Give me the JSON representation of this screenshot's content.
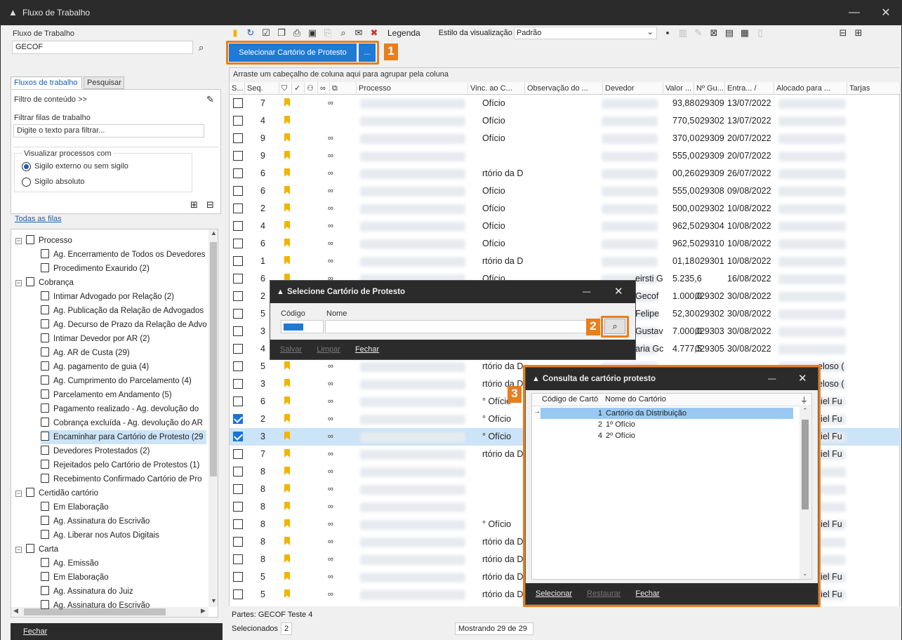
{
  "window": {
    "title": "Fluxo de Trabalho"
  },
  "left": {
    "fluxo_label": "Fluxo de Trabalho",
    "fluxo_value": "GECOF",
    "tabs": [
      "Fluxos de trabalho",
      "Pesquisar"
    ],
    "filter_content": "Filtro de conteúdo >>",
    "filter_label": "Filtrar filas de trabalho",
    "filter_placeholder": "Digite o texto para filtrar...",
    "visualizar_label": "Visualizar processos com",
    "radio1": "Sigilo externo ou sem sigilo",
    "radio2": "Sigilo absoluto",
    "todas_filas": "Todas as filas",
    "fechar": "Fechar"
  },
  "tree": [
    {
      "label": "Processo",
      "level": 0,
      "icon": "document-icon",
      "exp": "−"
    },
    {
      "label": "Ag. Encerramento de Todos os Devedores",
      "level": 1,
      "icon": "document-icon"
    },
    {
      "label": "Procedimento Exaurido (2)",
      "level": 1,
      "icon": "document-icon"
    },
    {
      "label": "Cobrança",
      "level": 0,
      "icon": "document-icon",
      "exp": "−"
    },
    {
      "label": "Intimar Advogado por Relação (2)",
      "level": 1,
      "icon": "document-icon"
    },
    {
      "label": "Ag. Publicação da Relação de Advogados",
      "level": 1,
      "icon": "document-icon"
    },
    {
      "label": "Ag. Decurso de Prazo da Relação de Advo",
      "level": 1,
      "icon": "clock-icon"
    },
    {
      "label": "Intimar Devedor por AR (2)",
      "level": 1,
      "icon": "document-icon"
    },
    {
      "label": "Ag. AR de Custa (29)",
      "level": 1,
      "icon": "document-icon"
    },
    {
      "label": "Ag. pagamento de guia (4)",
      "level": 1,
      "icon": "document-icon"
    },
    {
      "label": "Ag. Cumprimento do Parcelamento (4)",
      "level": 1,
      "icon": "document-icon"
    },
    {
      "label": "Parcelamento em Andamento (5)",
      "level": 1,
      "icon": "document-icon"
    },
    {
      "label": "Pagamento realizado - Ag. devolução do",
      "level": 1,
      "icon": "document-icon"
    },
    {
      "label": "Cobrança excluída - Ag. devolução do AR",
      "level": 1,
      "icon": "document-icon"
    },
    {
      "label": "Encaminhar para Cartório de Protesto (29",
      "level": 1,
      "icon": "documents-icon",
      "selected": true
    },
    {
      "label": "Devedores Protestados (2)",
      "level": 1,
      "icon": "documents-icon"
    },
    {
      "label": "Rejeitados pelo Cartório de Protestos (1)",
      "level": 1,
      "icon": "documents-icon"
    },
    {
      "label": "Recebimento Confirmado Cartório de Pro",
      "level": 1,
      "icon": "documents-icon"
    },
    {
      "label": "Certidão cartório",
      "level": 0,
      "icon": "certificate-icon",
      "exp": "−"
    },
    {
      "label": "Em Elaboração",
      "level": 1,
      "icon": "pen-icon"
    },
    {
      "label": "Ag. Assinatura do Escrivão",
      "level": 1,
      "icon": "signature-icon"
    },
    {
      "label": "Ag. Liberar nos Autos Digitais",
      "level": 1,
      "icon": "documents-icon"
    },
    {
      "label": "Carta",
      "level": 0,
      "icon": "certificate-icon",
      "exp": "−"
    },
    {
      "label": "Ag. Emissão",
      "level": 1,
      "icon": "document-icon"
    },
    {
      "label": "Em Elaboração",
      "level": 1,
      "icon": "pen-icon"
    },
    {
      "label": "Ag. Assinatura do Juiz",
      "level": 1,
      "icon": "signature-icon"
    },
    {
      "label": "Ag. Assinatura do Escrivão",
      "level": 1,
      "icon": "signature-icon"
    }
  ],
  "toolbar": {
    "legenda": "Legenda",
    "estilo_label": "Estilo da visualização",
    "estilo_value": "Padrão",
    "select_btn": "Selecionar Cartório de Protesto",
    "more_btn": "...",
    "step1": "1"
  },
  "grid": {
    "group_hint": "Arraste um cabeçalho de coluna aqui para agrupar pela coluna",
    "headers": [
      "S...",
      "Seq.",
      "Processo",
      "Vinc. ao C...",
      "Observação do ...",
      "Devedor",
      "Valor ...",
      "Nº Gu...",
      "Entra... /",
      "Alocado para ...",
      "Tarjas"
    ],
    "rows": [
      {
        "sel": false,
        "seq": "7",
        "link": true,
        "vinc": "Ofício",
        "dev": "",
        "valor": "93,88",
        "guia": "029309",
        "data": "13/07/2022"
      },
      {
        "sel": false,
        "seq": "4",
        "link": false,
        "vinc": "Ofício",
        "dev": "",
        "valor": "770,5",
        "guia": "029302",
        "data": "13/07/2022"
      },
      {
        "sel": false,
        "seq": "9",
        "link": true,
        "vinc": "Ofício",
        "dev": "",
        "valor": "370,0",
        "guia": "029309",
        "data": "20/07/2022"
      },
      {
        "sel": false,
        "seq": "9",
        "link": true,
        "vinc": "",
        "dev": "",
        "valor": "555,0",
        "guia": "029309",
        "data": "20/07/2022"
      },
      {
        "sel": false,
        "seq": "6",
        "link": true,
        "vinc": "rtório da D",
        "dev": "",
        "valor": "00,26",
        "guia": "029309",
        "data": "26/07/2022"
      },
      {
        "sel": false,
        "seq": "6",
        "link": true,
        "vinc": "Ofício",
        "dev": "",
        "valor": "555,0",
        "guia": "029308",
        "data": "09/08/2022"
      },
      {
        "sel": false,
        "seq": "2",
        "link": true,
        "vinc": "Ofício",
        "dev": "",
        "valor": "500,0",
        "guia": "029302",
        "data": "10/08/2022"
      },
      {
        "sel": false,
        "seq": "4",
        "link": true,
        "vinc": "Ofício",
        "dev": "",
        "valor": "962,5",
        "guia": "029304",
        "data": "10/08/2022"
      },
      {
        "sel": false,
        "seq": "6",
        "link": true,
        "vinc": "Ofício",
        "dev": "",
        "valor": "962,5",
        "guia": "029310",
        "data": "10/08/2022"
      },
      {
        "sel": false,
        "seq": "1",
        "link": true,
        "vinc": "rtório da D",
        "dev": "",
        "valor": "01,18",
        "guia": "029301",
        "data": "10/08/2022"
      },
      {
        "sel": false,
        "seq": "6",
        "link": true,
        "vinc": "Ofício",
        "dev": "eirsti Gecof",
        "valor": "5.235,6",
        "guia": "",
        "data": "16/08/2022"
      },
      {
        "sel": false,
        "seq": "2",
        "link": true,
        "vinc": "",
        "dev": "Gecof",
        "valor": "1.000,0",
        "guia": "029302",
        "data": "30/08/2022"
      },
      {
        "sel": false,
        "seq": "5",
        "link": true,
        "vinc": "",
        "dev": "Felipe",
        "valor": "52,30",
        "guia": "029302",
        "data": "30/08/2022"
      },
      {
        "sel": false,
        "seq": "3",
        "link": true,
        "vinc": "",
        "dev": "Gustavc",
        "valor": "7.000,0",
        "guia": "029303",
        "data": "30/08/2022"
      },
      {
        "sel": false,
        "seq": "4",
        "link": true,
        "vinc": "",
        "dev": "aria Gc",
        "valor": "4.777,5",
        "guia": "029305",
        "data": "30/08/2022"
      },
      {
        "sel": false,
        "seq": "5",
        "link": true,
        "vinc": "rtório da D",
        "dev": "",
        "valor": "",
        "guia": "",
        "data": "",
        "right": "eloso ("
      },
      {
        "sel": false,
        "seq": "3",
        "link": true,
        "vinc": "rtório da D",
        "dev": "",
        "valor": "",
        "guia": "",
        "data": "",
        "right": "eloso ("
      },
      {
        "sel": false,
        "seq": "6",
        "link": true,
        "vinc": "° Ofício",
        "dev": "",
        "valor": "",
        "guia": "",
        "data": "",
        "right": "riel Fu"
      },
      {
        "sel": true,
        "seq": "2",
        "link": true,
        "vinc": "° Ofício",
        "dev": "",
        "valor": "",
        "guia": "",
        "data": "",
        "right": "riel Fu"
      },
      {
        "sel": true,
        "seq": "3",
        "link": true,
        "vinc": "° Ofício",
        "dev": "",
        "valor": "",
        "guia": "",
        "data": "",
        "right": "riel Fu",
        "highlight": true
      },
      {
        "sel": false,
        "seq": "7",
        "link": true,
        "vinc": "rtório da D",
        "dev": "",
        "valor": "",
        "guia": "",
        "data": "",
        "right": "riel Fu"
      },
      {
        "sel": false,
        "seq": "8",
        "link": true,
        "vinc": "",
        "dev": "",
        "valor": "",
        "guia": "",
        "data": "",
        "right": ""
      },
      {
        "sel": false,
        "seq": "8",
        "link": true,
        "vinc": "",
        "dev": "",
        "valor": "",
        "guia": "",
        "data": "",
        "right": ""
      },
      {
        "sel": false,
        "seq": "8",
        "link": true,
        "vinc": "",
        "dev": "",
        "valor": "",
        "guia": "",
        "data": "",
        "right": ""
      },
      {
        "sel": false,
        "seq": "8",
        "link": true,
        "vinc": "° Ofício",
        "dev": "",
        "valor": "",
        "guia": "",
        "data": "",
        "right": "riel Fu"
      },
      {
        "sel": false,
        "seq": "8",
        "link": true,
        "vinc": "rtório da D",
        "dev": "",
        "valor": "",
        "guia": "",
        "data": "",
        "right": ""
      },
      {
        "sel": false,
        "seq": "8",
        "link": true,
        "vinc": "rtório da D",
        "dev": "",
        "valor": "",
        "guia": "",
        "data": "",
        "right": ""
      },
      {
        "sel": false,
        "seq": "5",
        "link": true,
        "vinc": "rtório da D",
        "dev": "",
        "valor": "",
        "guia": "",
        "data": "",
        "right": "riel Fu"
      },
      {
        "sel": false,
        "seq": "5",
        "link": true,
        "vinc": "rtório da D",
        "dev": "",
        "valor": "",
        "guia": "",
        "data": "",
        "right": "riel Fu"
      }
    ]
  },
  "status": {
    "partes": "Partes: GECOF Teste 4",
    "selecionados_label": "Selecionados",
    "selecionados_value": "2",
    "mostrando": "Mostrando 29 de 29"
  },
  "dialog1": {
    "title": "Selecione Cartório de Protesto",
    "codigo_label": "Código",
    "nome_label": "Nome",
    "salvar": "Salvar",
    "limpar": "Limpar",
    "fechar": "Fechar",
    "step2": "2"
  },
  "dialog2": {
    "title": "Consulta de cartório protesto",
    "col1": "Código de Cartó",
    "col2": "Nome do Cartório",
    "rows": [
      {
        "code": "1",
        "name": "Cartório da Distribuição"
      },
      {
        "code": "2",
        "name": "1º Ofício"
      },
      {
        "code": "4",
        "name": "2º Ofício"
      }
    ],
    "selecionar": "Selecionar",
    "restaurar": "Restaurar",
    "fechar": "Fechar",
    "step3": "3"
  },
  "colors": {
    "accent": "#1f7ad6",
    "highlight": "#e87e1e",
    "dark": "#2b2b2b",
    "selection": "#cce4f7"
  }
}
